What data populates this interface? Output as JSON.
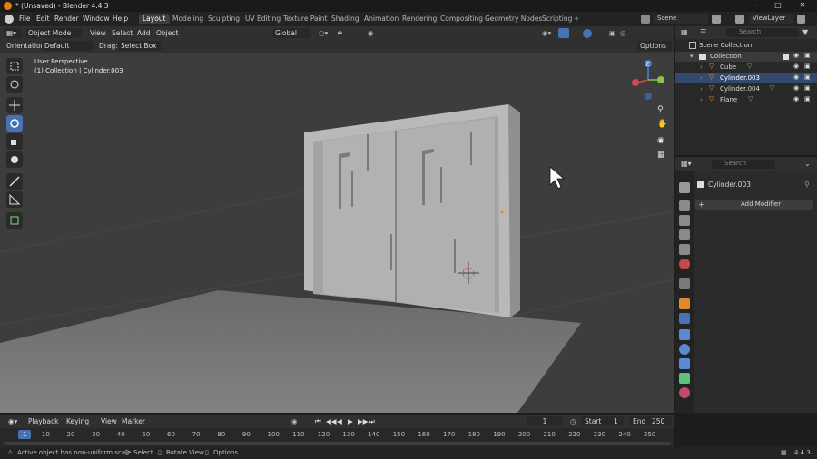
{
  "window": {
    "title": "* (Unsaved) - Blender 4.4.3",
    "version": "4.4.3"
  },
  "menu": [
    "File",
    "Edit",
    "Render",
    "Window",
    "Help"
  ],
  "workspaces": [
    "Layout",
    "Modeling",
    "Sculpting",
    "UV Editing",
    "Texture Paint",
    "Shading",
    "Animation",
    "Rendering",
    "Compositing",
    "Geometry Nodes",
    "Scripting"
  ],
  "active_workspace": "Layout",
  "scene": {
    "label": "Scene",
    "view_layer": "ViewLayer"
  },
  "viewport_header": {
    "mode": "Object Mode",
    "menus": [
      "View",
      "Select",
      "Add",
      "Object"
    ],
    "transform_orientation": "Global",
    "orientation_label": "Orientation:",
    "orientation_value": "Default",
    "drag_label": "Drag:",
    "drag_value": "Select Box",
    "options": "Options"
  },
  "viewport": {
    "perspective": "User Perspective",
    "context": "(1) Collection | Cylinder.003"
  },
  "outliner": {
    "search_placeholder": "Search",
    "root": "Scene Collection",
    "collection": "Collection",
    "items": [
      {
        "name": "Cube",
        "selected": false
      },
      {
        "name": "Cylinder.003",
        "selected": true
      },
      {
        "name": "Cylinder.004",
        "selected": false
      },
      {
        "name": "Plane",
        "selected": false
      }
    ]
  },
  "properties": {
    "search_placeholder": "Search",
    "object_name": "Cylinder.003",
    "add_modifier": "Add Modifier"
  },
  "timeline": {
    "menus": [
      "Playback",
      "Keying",
      "View",
      "Marker"
    ],
    "current_frame": "1",
    "start_label": "Start",
    "start": "1",
    "end_label": "End",
    "end": "250",
    "ticks": [
      "1",
      "10",
      "20",
      "30",
      "40",
      "50",
      "60",
      "70",
      "80",
      "90",
      "100",
      "110",
      "120",
      "130",
      "140",
      "150",
      "160",
      "170",
      "180",
      "190",
      "200",
      "210",
      "220",
      "230",
      "240",
      "250"
    ]
  },
  "statusbar": {
    "message": "Active object has non-uniform scale",
    "hints": [
      "Select",
      "Rotate View",
      "Options"
    ],
    "version": "4.4.3"
  },
  "colors": {
    "accent": "#4772b3",
    "blender_orange": "#e87d0d",
    "selection": "#334a6d"
  }
}
